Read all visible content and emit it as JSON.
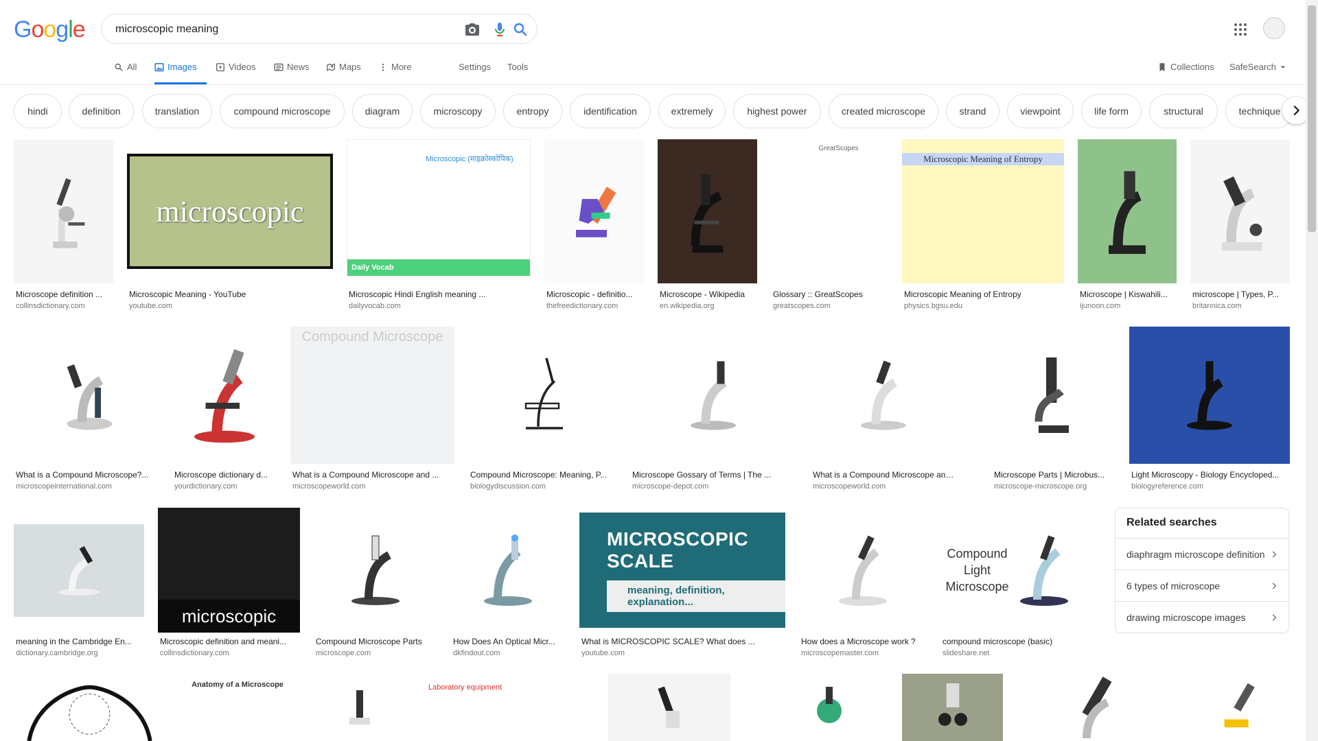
{
  "logo": {
    "text": [
      "G",
      "o",
      "o",
      "g",
      "l",
      "e"
    ],
    "colors": [
      "#4285F4",
      "#EA4335",
      "#FBBC05",
      "#4285F4",
      "#34A853",
      "#EA4335"
    ]
  },
  "search": {
    "value": "microscopic meaning",
    "placeholder": ""
  },
  "tabs": [
    {
      "label": "All",
      "icon": "search-icon"
    },
    {
      "label": "Images",
      "icon": "image-icon",
      "active": true
    },
    {
      "label": "Videos",
      "icon": "video-icon"
    },
    {
      "label": "News",
      "icon": "news-icon"
    },
    {
      "label": "Maps",
      "icon": "map-icon"
    },
    {
      "label": "More",
      "icon": "more-vert-icon"
    }
  ],
  "tools": {
    "settings": "Settings",
    "tools": "Tools"
  },
  "right_links": {
    "collections": "Collections",
    "safesearch": "SafeSearch"
  },
  "chips": [
    "hindi",
    "definition",
    "translation",
    "compound microscope",
    "diagram",
    "microscopy",
    "entropy",
    "identification",
    "extremely",
    "highest power",
    "created microscope",
    "strand",
    "viewpoint",
    "life form",
    "structural",
    "technique"
  ],
  "results": [
    {
      "caption": "Microscope definition ...",
      "source": "collinsdictionary.com"
    },
    {
      "caption": "Microscopic Meaning - YouTube",
      "source": "youtube.com",
      "thumb_text": "microscopic"
    },
    {
      "caption": "Microscopic Hindi English meaning ...",
      "source": "dailyvocab.com",
      "thumb_text": "Microscopic (माइक्रोस्कोपिक)",
      "thumb_footer": "Daily Vocab"
    },
    {
      "caption": "Microscopic - definitio...",
      "source": "thefreedictionary.com"
    },
    {
      "caption": "Microscope - Wikipedia",
      "source": "en.wikipedia.org"
    },
    {
      "caption": "Glossary :: GreatScopes",
      "source": "greatscopes.com",
      "thumb_text": "GreatScopes"
    },
    {
      "caption": "Microscopic Meaning of Entropy",
      "source": "physics.bgsu.edu",
      "thumb_text": "Microscopic Meaning of Entropy"
    },
    {
      "caption": "Microscope | Kiswahili...",
      "source": "ijunoon.com"
    },
    {
      "caption": "microscope | Types, P...",
      "source": "britannica.com"
    },
    {
      "caption": "What is a Compound Microscope?...",
      "source": "microscopeinternational.com"
    },
    {
      "caption": "Microscope dictionary d...",
      "source": "yourdictionary.com"
    },
    {
      "caption": "What is a Compound Microscope and ...",
      "source": "microscopeworld.com",
      "thumb_text": "Compound Microscope"
    },
    {
      "caption": "Compound Microscope: Meaning, P...",
      "source": "biologydiscussion.com"
    },
    {
      "caption": "Microscope Gossary of Terms | The ...",
      "source": "microscope-depot.com"
    },
    {
      "caption": "What is a Compound Microscope and W...",
      "source": "microscopeworld.com"
    },
    {
      "caption": "Microscope Parts | Microbus...",
      "source": "microscope-microscope.org"
    },
    {
      "caption": "Light Microscopy - Biology Encycloped...",
      "source": "biologyreference.com"
    },
    {
      "caption": "meaning in the Cambridge En...",
      "source": "dictionary.cambridge.org"
    },
    {
      "caption": "Microscopic definition and meani...",
      "source": "collinsdictionary.com",
      "thumb_text": "microscopic"
    },
    {
      "caption": "Compound Microscope Parts",
      "source": "microscope.com"
    },
    {
      "caption": "How Does An Optical Micr...",
      "source": "dkfindout.com"
    },
    {
      "caption": "What is MICROSCOPIC SCALE? What does ...",
      "source": "youtube.com",
      "thumb_text": "MICROSCOPIC SCALE",
      "thumb_sub": "meaning, definition, explanation..."
    },
    {
      "caption": "How does a Microscope work ?",
      "source": "microscopemaster.com"
    },
    {
      "caption": "compound microscope (basic)",
      "source": "slideshare.net",
      "thumb_text": "Compound Light Microscope"
    }
  ],
  "bottom_row_labels": [
    "Anatomy of a Microscope",
    "Laboratory equipment"
  ],
  "related": {
    "title": "Related searches",
    "items": [
      "diaphragm microscope definition",
      "6 types of microscope",
      "drawing microscope images"
    ]
  }
}
